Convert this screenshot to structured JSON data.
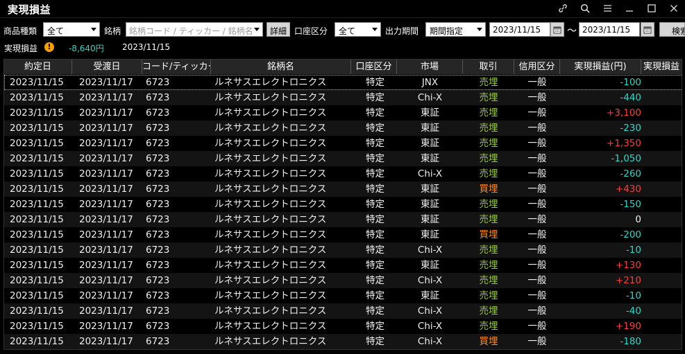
{
  "window": {
    "title": "実現損益",
    "icons": [
      "link-icon",
      "search-icon",
      "menu-icon",
      "minimize-icon",
      "maximize-icon",
      "close-icon"
    ]
  },
  "filters": {
    "product_label": "商品種類",
    "product_value": "全て",
    "symbol_label": "銘柄",
    "symbol_placeholder": "銘柄コード / ティッカー / 銘柄名",
    "detail_button": "詳細",
    "account_label": "口座区分",
    "account_value": "全て",
    "period_label": "出力期間",
    "period_value": "期間指定",
    "date_from": "2023/11/15",
    "tilde": "〜",
    "date_to": "2023/11/15",
    "search_button": "検索"
  },
  "summary": {
    "label": "実現損益",
    "value": "-8,640円",
    "date": "2023/11/15"
  },
  "colors": {
    "sell": "#9acd32",
    "buy": "#ff8c1a",
    "loss": "#2ad9c8",
    "profit": "#ff3b3b"
  },
  "table": {
    "columns": [
      "約定日",
      "受渡日",
      "コード/ティッカー",
      "銘柄名",
      "口座区分",
      "市場",
      "取引",
      "信用区分",
      "実現損益(円)",
      "実現損益"
    ],
    "rows": [
      [
        "2023/11/15",
        "2023/11/17",
        "6723",
        "ルネサスエレクトロニクス",
        "特定",
        "JNX",
        "売埋",
        "一般",
        "-100"
      ],
      [
        "2023/11/15",
        "2023/11/17",
        "6723",
        "ルネサスエレクトロニクス",
        "特定",
        "Chi-X",
        "売埋",
        "一般",
        "-440"
      ],
      [
        "2023/11/15",
        "2023/11/17",
        "6723",
        "ルネサスエレクトロニクス",
        "特定",
        "東証",
        "売埋",
        "一般",
        "+3,100"
      ],
      [
        "2023/11/15",
        "2023/11/17",
        "6723",
        "ルネサスエレクトロニクス",
        "特定",
        "東証",
        "売埋",
        "一般",
        "-230"
      ],
      [
        "2023/11/15",
        "2023/11/17",
        "6723",
        "ルネサスエレクトロニクス",
        "特定",
        "東証",
        "売埋",
        "一般",
        "+1,350"
      ],
      [
        "2023/11/15",
        "2023/11/17",
        "6723",
        "ルネサスエレクトロニクス",
        "特定",
        "東証",
        "売埋",
        "一般",
        "-1,050"
      ],
      [
        "2023/11/15",
        "2023/11/17",
        "6723",
        "ルネサスエレクトロニクス",
        "特定",
        "Chi-X",
        "売埋",
        "一般",
        "-260"
      ],
      [
        "2023/11/15",
        "2023/11/17",
        "6723",
        "ルネサスエレクトロニクス",
        "特定",
        "東証",
        "買埋",
        "一般",
        "+430"
      ],
      [
        "2023/11/15",
        "2023/11/17",
        "6723",
        "ルネサスエレクトロニクス",
        "特定",
        "東証",
        "売埋",
        "一般",
        "-150"
      ],
      [
        "2023/11/15",
        "2023/11/17",
        "6723",
        "ルネサスエレクトロニクス",
        "特定",
        "東証",
        "売埋",
        "一般",
        "0"
      ],
      [
        "2023/11/15",
        "2023/11/17",
        "6723",
        "ルネサスエレクトロニクス",
        "特定",
        "東証",
        "買埋",
        "一般",
        "-200"
      ],
      [
        "2023/11/15",
        "2023/11/17",
        "6723",
        "ルネサスエレクトロニクス",
        "特定",
        "Chi-X",
        "売埋",
        "一般",
        "-10"
      ],
      [
        "2023/11/15",
        "2023/11/17",
        "6723",
        "ルネサスエレクトロニクス",
        "特定",
        "東証",
        "売埋",
        "一般",
        "+130"
      ],
      [
        "2023/11/15",
        "2023/11/17",
        "6723",
        "ルネサスエレクトロニクス",
        "特定",
        "Chi-X",
        "売埋",
        "一般",
        "+210"
      ],
      [
        "2023/11/15",
        "2023/11/17",
        "6723",
        "ルネサスエレクトロニクス",
        "特定",
        "東証",
        "売埋",
        "一般",
        "-10"
      ],
      [
        "2023/11/15",
        "2023/11/17",
        "6723",
        "ルネサスエレクトロニクス",
        "特定",
        "Chi-X",
        "売埋",
        "一般",
        "-40"
      ],
      [
        "2023/11/15",
        "2023/11/17",
        "6723",
        "ルネサスエレクトロニクス",
        "特定",
        "Chi-X",
        "売埋",
        "一般",
        "+190"
      ],
      [
        "2023/11/15",
        "2023/11/17",
        "6723",
        "ルネサスエレクトロニクス",
        "特定",
        "Chi-X",
        "買埋",
        "一般",
        "-180"
      ]
    ]
  }
}
